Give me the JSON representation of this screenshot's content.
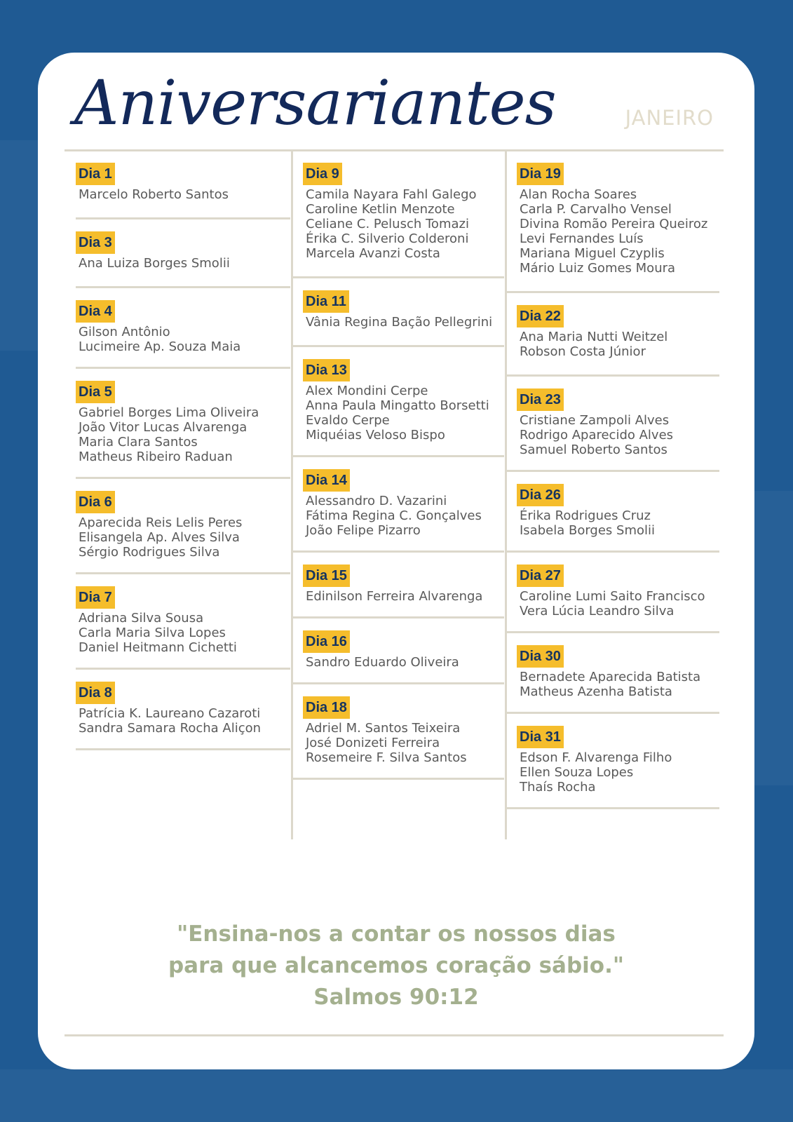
{
  "header": {
    "title": "Aniversariantes",
    "month": "JANEIRO"
  },
  "columns": [
    [
      {
        "day": "Dia 1",
        "names": [
          "Marcelo Roberto Santos"
        ]
      },
      {
        "day": "Dia 3",
        "names": [
          "Ana Luiza Borges Smolii"
        ]
      },
      {
        "day": "Dia 4",
        "names": [
          "Gilson Antônio",
          "Lucimeire Ap. Souza Maia"
        ]
      },
      {
        "day": "Dia 5",
        "names": [
          "Gabriel Borges Lima Oliveira",
          "João Vitor Lucas Alvarenga",
          "Maria Clara Santos",
          "Matheus Ribeiro Raduan"
        ]
      },
      {
        "day": "Dia 6",
        "names": [
          "Aparecida Reis Lelis Peres",
          "Elisangela Ap. Alves Silva",
          "Sérgio Rodrigues Silva"
        ]
      },
      {
        "day": "Dia 7",
        "names": [
          "Adriana Silva Sousa",
          "Carla Maria Silva Lopes",
          "Daniel Heitmann Cichetti"
        ]
      },
      {
        "day": "Dia 8",
        "names": [
          "Patrícia K. Laureano Cazaroti",
          "Sandra Samara Rocha Aliçon"
        ]
      }
    ],
    [
      {
        "day": "Dia 9",
        "names": [
          "Camila Nayara Fahl Galego",
          "Caroline Ketlin Menzote",
          "Celiane C. Pelusch Tomazi",
          "Érika C. Silverio Colderoni",
          "Marcela Avanzi Costa"
        ]
      },
      {
        "day": "Dia 11",
        "names": [
          "Vânia Regina Bação Pellegrini"
        ]
      },
      {
        "day": "Dia 13",
        "names": [
          "Alex Mondini Cerpe",
          "Anna Paula Mingatto Borsetti",
          "Evaldo Cerpe",
          "Miquéias Veloso Bispo"
        ]
      },
      {
        "day": "Dia 14",
        "names": [
          "Alessandro D. Vazarini",
          "Fátima Regina C. Gonçalves",
          "João Felipe Pizarro"
        ]
      },
      {
        "day": "Dia 15",
        "names": [
          "Edinilson Ferreira Alvarenga"
        ]
      },
      {
        "day": "Dia 16",
        "names": [
          "Sandro Eduardo Oliveira"
        ]
      },
      {
        "day": "Dia 18",
        "names": [
          "Adriel M. Santos Teixeira",
          "José Donizeti Ferreira",
          "Rosemeire F. Silva Santos"
        ]
      }
    ],
    [
      {
        "day": "Dia 19",
        "names": [
          "Alan Rocha Soares",
          "Carla P. Carvalho Vensel",
          "Divina Romão Pereira Queiroz",
          "Levi Fernandes Luís",
          "Mariana Miguel Czyplis",
          "Mário Luiz Gomes Moura"
        ]
      },
      {
        "day": "Dia 22",
        "names": [
          "Ana Maria Nutti Weitzel",
          "Robson Costa Júnior"
        ]
      },
      {
        "day": "Dia 23",
        "names": [
          "Cristiane Zampoli Alves",
          "Rodrigo Aparecido Alves",
          "Samuel Roberto Santos"
        ]
      },
      {
        "day": "Dia 26",
        "names": [
          "Érika Rodrigues Cruz",
          "Isabela Borges Smolii"
        ]
      },
      {
        "day": "Dia 27",
        "names": [
          "Caroline Lumi Saito Francisco",
          "Vera Lúcia Leandro Silva"
        ]
      },
      {
        "day": "Dia 30",
        "names": [
          "Bernadete Aparecida Batista",
          "Matheus Azenha Batista"
        ]
      },
      {
        "day": "Dia 31",
        "names": [
          "Edson F. Alvarenga Filho",
          "Ellen Souza Lopes",
          "Thaís Rocha"
        ]
      }
    ]
  ],
  "quote": {
    "line1": "\"Ensina-nos a contar os nossos dias",
    "line2": "para que alcancemos coração sábio.\"",
    "reference": "Salmos 90:12"
  },
  "colors": {
    "background": "#1f5a93",
    "title": "#13295a",
    "tag": "#f5bd2c",
    "quote": "#a4b08f"
  }
}
